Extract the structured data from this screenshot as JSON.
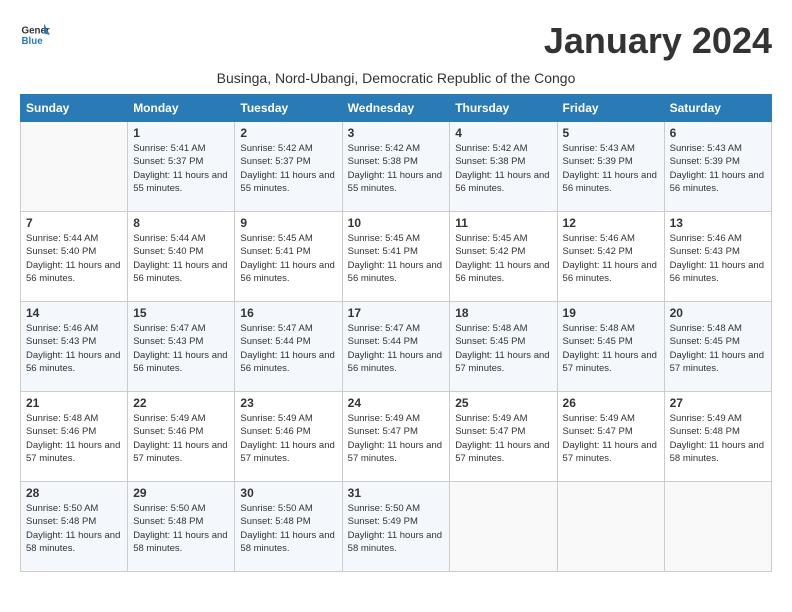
{
  "logo": {
    "line1": "General",
    "line2": "Blue"
  },
  "title": "January 2024",
  "subtitle": "Businga, Nord-Ubangi, Democratic Republic of the Congo",
  "days_of_week": [
    "Sunday",
    "Monday",
    "Tuesday",
    "Wednesday",
    "Thursday",
    "Friday",
    "Saturday"
  ],
  "weeks": [
    [
      {
        "day": "",
        "sunrise": "",
        "sunset": "",
        "daylight": ""
      },
      {
        "day": "1",
        "sunrise": "Sunrise: 5:41 AM",
        "sunset": "Sunset: 5:37 PM",
        "daylight": "Daylight: 11 hours and 55 minutes."
      },
      {
        "day": "2",
        "sunrise": "Sunrise: 5:42 AM",
        "sunset": "Sunset: 5:37 PM",
        "daylight": "Daylight: 11 hours and 55 minutes."
      },
      {
        "day": "3",
        "sunrise": "Sunrise: 5:42 AM",
        "sunset": "Sunset: 5:38 PM",
        "daylight": "Daylight: 11 hours and 55 minutes."
      },
      {
        "day": "4",
        "sunrise": "Sunrise: 5:42 AM",
        "sunset": "Sunset: 5:38 PM",
        "daylight": "Daylight: 11 hours and 56 minutes."
      },
      {
        "day": "5",
        "sunrise": "Sunrise: 5:43 AM",
        "sunset": "Sunset: 5:39 PM",
        "daylight": "Daylight: 11 hours and 56 minutes."
      },
      {
        "day": "6",
        "sunrise": "Sunrise: 5:43 AM",
        "sunset": "Sunset: 5:39 PM",
        "daylight": "Daylight: 11 hours and 56 minutes."
      }
    ],
    [
      {
        "day": "7",
        "sunrise": "Sunrise: 5:44 AM",
        "sunset": "Sunset: 5:40 PM",
        "daylight": "Daylight: 11 hours and 56 minutes."
      },
      {
        "day": "8",
        "sunrise": "Sunrise: 5:44 AM",
        "sunset": "Sunset: 5:40 PM",
        "daylight": "Daylight: 11 hours and 56 minutes."
      },
      {
        "day": "9",
        "sunrise": "Sunrise: 5:45 AM",
        "sunset": "Sunset: 5:41 PM",
        "daylight": "Daylight: 11 hours and 56 minutes."
      },
      {
        "day": "10",
        "sunrise": "Sunrise: 5:45 AM",
        "sunset": "Sunset: 5:41 PM",
        "daylight": "Daylight: 11 hours and 56 minutes."
      },
      {
        "day": "11",
        "sunrise": "Sunrise: 5:45 AM",
        "sunset": "Sunset: 5:42 PM",
        "daylight": "Daylight: 11 hours and 56 minutes."
      },
      {
        "day": "12",
        "sunrise": "Sunrise: 5:46 AM",
        "sunset": "Sunset: 5:42 PM",
        "daylight": "Daylight: 11 hours and 56 minutes."
      },
      {
        "day": "13",
        "sunrise": "Sunrise: 5:46 AM",
        "sunset": "Sunset: 5:43 PM",
        "daylight": "Daylight: 11 hours and 56 minutes."
      }
    ],
    [
      {
        "day": "14",
        "sunrise": "Sunrise: 5:46 AM",
        "sunset": "Sunset: 5:43 PM",
        "daylight": "Daylight: 11 hours and 56 minutes."
      },
      {
        "day": "15",
        "sunrise": "Sunrise: 5:47 AM",
        "sunset": "Sunset: 5:43 PM",
        "daylight": "Daylight: 11 hours and 56 minutes."
      },
      {
        "day": "16",
        "sunrise": "Sunrise: 5:47 AM",
        "sunset": "Sunset: 5:44 PM",
        "daylight": "Daylight: 11 hours and 56 minutes."
      },
      {
        "day": "17",
        "sunrise": "Sunrise: 5:47 AM",
        "sunset": "Sunset: 5:44 PM",
        "daylight": "Daylight: 11 hours and 56 minutes."
      },
      {
        "day": "18",
        "sunrise": "Sunrise: 5:48 AM",
        "sunset": "Sunset: 5:45 PM",
        "daylight": "Daylight: 11 hours and 57 minutes."
      },
      {
        "day": "19",
        "sunrise": "Sunrise: 5:48 AM",
        "sunset": "Sunset: 5:45 PM",
        "daylight": "Daylight: 11 hours and 57 minutes."
      },
      {
        "day": "20",
        "sunrise": "Sunrise: 5:48 AM",
        "sunset": "Sunset: 5:45 PM",
        "daylight": "Daylight: 11 hours and 57 minutes."
      }
    ],
    [
      {
        "day": "21",
        "sunrise": "Sunrise: 5:48 AM",
        "sunset": "Sunset: 5:46 PM",
        "daylight": "Daylight: 11 hours and 57 minutes."
      },
      {
        "day": "22",
        "sunrise": "Sunrise: 5:49 AM",
        "sunset": "Sunset: 5:46 PM",
        "daylight": "Daylight: 11 hours and 57 minutes."
      },
      {
        "day": "23",
        "sunrise": "Sunrise: 5:49 AM",
        "sunset": "Sunset: 5:46 PM",
        "daylight": "Daylight: 11 hours and 57 minutes."
      },
      {
        "day": "24",
        "sunrise": "Sunrise: 5:49 AM",
        "sunset": "Sunset: 5:47 PM",
        "daylight": "Daylight: 11 hours and 57 minutes."
      },
      {
        "day": "25",
        "sunrise": "Sunrise: 5:49 AM",
        "sunset": "Sunset: 5:47 PM",
        "daylight": "Daylight: 11 hours and 57 minutes."
      },
      {
        "day": "26",
        "sunrise": "Sunrise: 5:49 AM",
        "sunset": "Sunset: 5:47 PM",
        "daylight": "Daylight: 11 hours and 57 minutes."
      },
      {
        "day": "27",
        "sunrise": "Sunrise: 5:49 AM",
        "sunset": "Sunset: 5:48 PM",
        "daylight": "Daylight: 11 hours and 58 minutes."
      }
    ],
    [
      {
        "day": "28",
        "sunrise": "Sunrise: 5:50 AM",
        "sunset": "Sunset: 5:48 PM",
        "daylight": "Daylight: 11 hours and 58 minutes."
      },
      {
        "day": "29",
        "sunrise": "Sunrise: 5:50 AM",
        "sunset": "Sunset: 5:48 PM",
        "daylight": "Daylight: 11 hours and 58 minutes."
      },
      {
        "day": "30",
        "sunrise": "Sunrise: 5:50 AM",
        "sunset": "Sunset: 5:48 PM",
        "daylight": "Daylight: 11 hours and 58 minutes."
      },
      {
        "day": "31",
        "sunrise": "Sunrise: 5:50 AM",
        "sunset": "Sunset: 5:49 PM",
        "daylight": "Daylight: 11 hours and 58 minutes."
      },
      {
        "day": "",
        "sunrise": "",
        "sunset": "",
        "daylight": ""
      },
      {
        "day": "",
        "sunrise": "",
        "sunset": "",
        "daylight": ""
      },
      {
        "day": "",
        "sunrise": "",
        "sunset": "",
        "daylight": ""
      }
    ]
  ]
}
